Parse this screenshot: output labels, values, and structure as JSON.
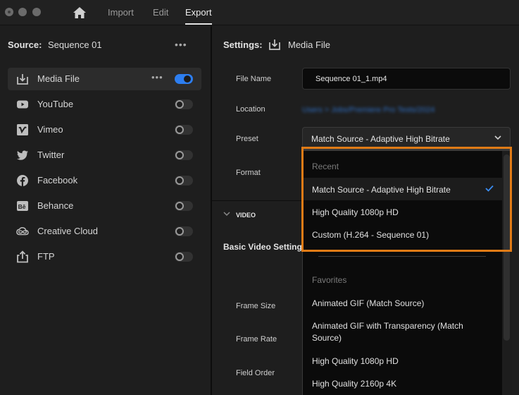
{
  "topbar": {
    "window_controls": [
      "close",
      "minimize",
      "maximize"
    ],
    "home_icon": "home-icon",
    "tabs": [
      {
        "label": "Import",
        "active": false
      },
      {
        "label": "Edit",
        "active": false
      },
      {
        "label": "Export",
        "active": true
      }
    ]
  },
  "source": {
    "label": "Source:",
    "value": "Sequence 01",
    "more_icon": "•••"
  },
  "destinations": [
    {
      "label": "Media File",
      "icon": "download-icon",
      "enabled": true,
      "active": true,
      "more": "•••"
    },
    {
      "label": "YouTube",
      "icon": "youtube-icon",
      "enabled": false
    },
    {
      "label": "Vimeo",
      "icon": "vimeo-icon",
      "enabled": false
    },
    {
      "label": "Twitter",
      "icon": "twitter-icon",
      "enabled": false
    },
    {
      "label": "Facebook",
      "icon": "facebook-icon",
      "enabled": false
    },
    {
      "label": "Behance",
      "icon": "behance-icon",
      "enabled": false
    },
    {
      "label": "Creative Cloud",
      "icon": "creative-cloud-icon",
      "enabled": false
    },
    {
      "label": "FTP",
      "icon": "upload-icon",
      "enabled": false
    }
  ],
  "settings": {
    "label": "Settings:",
    "value": "Media File",
    "fields": {
      "file_name_label": "File Name",
      "file_name_value": "Sequence 01_1.mp4",
      "location_label": "Location",
      "location_value": "Users > Jobs/Premiere Pro Tests/2024",
      "preset_label": "Preset",
      "preset_value": "Match Source - Adaptive High Bitrate",
      "format_label": "Format"
    },
    "video_section": "VIDEO",
    "basic_video_settings": "Basic Video Settings",
    "video_fields": [
      "Frame Size",
      "Frame Rate",
      "Field Order"
    ]
  },
  "preset_dropdown": {
    "recent_header": "Recent",
    "recent_items": [
      {
        "label": "Match Source - Adaptive High Bitrate",
        "selected": true
      },
      {
        "label": "High Quality 1080p HD",
        "selected": false
      },
      {
        "label": "Custom (H.264 - Sequence 01)",
        "selected": false
      }
    ],
    "favorites_header": "Favorites",
    "favorite_items": [
      {
        "label": "Animated GIF (Match Source)"
      },
      {
        "label": "Animated GIF with Transparency (Match Source)"
      },
      {
        "label": "High Quality 1080p HD"
      },
      {
        "label": "High Quality 2160p 4K"
      }
    ]
  },
  "colors": {
    "accent": "#2d7ef0",
    "highlight": "#e07b16",
    "background": "#1e1e1e",
    "dropdown_bg": "#0b0b0b",
    "link": "#2f6fc4"
  }
}
